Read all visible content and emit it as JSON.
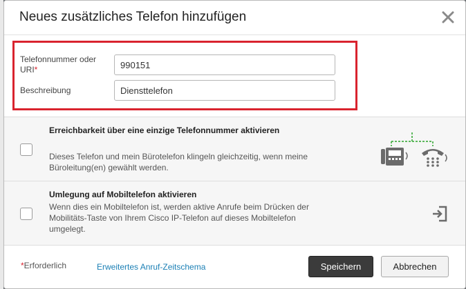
{
  "dialog": {
    "title": "Neues zusätzliches Telefon hinzufügen",
    "close_icon": "close-icon"
  },
  "form": {
    "phone_label": "Telefonnummer oder URI",
    "required_marker": "*",
    "phone_value": "990151",
    "description_label": "Beschreibung",
    "description_value": "Diensttelefon"
  },
  "options": [
    {
      "title": "Erreichbarkeit über eine einzige Telefonnummer aktivieren",
      "description": "Dieses Telefon und mein Bürotelefon klingeln gleichzeitig, wenn meine Büroleitung(en) gewählt werden.",
      "checked": false,
      "icon": "single-number-reach-icon"
    },
    {
      "title": "Umlegung auf Mobiltelefon aktivieren",
      "description": "Wenn dies ein Mobiltelefon ist, werden aktive Anrufe beim Drücken der Mobilitäts-Taste von Ihrem Cisco IP-Telefon auf dieses Mobiltelefon umgelegt.",
      "checked": false,
      "icon": "transfer-to-mobile-icon"
    }
  ],
  "footer": {
    "required_marker": "*",
    "required_note": "Erforderlich",
    "schedule_link": "Erweitertes Anruf-Zeitschema",
    "save_label": "Speichern",
    "cancel_label": "Abbrechen"
  },
  "colors": {
    "highlight": "#d9232e",
    "link": "#1a7fb5",
    "primary_button": "#3b3b3b",
    "icon_green": "#5cb85c"
  }
}
